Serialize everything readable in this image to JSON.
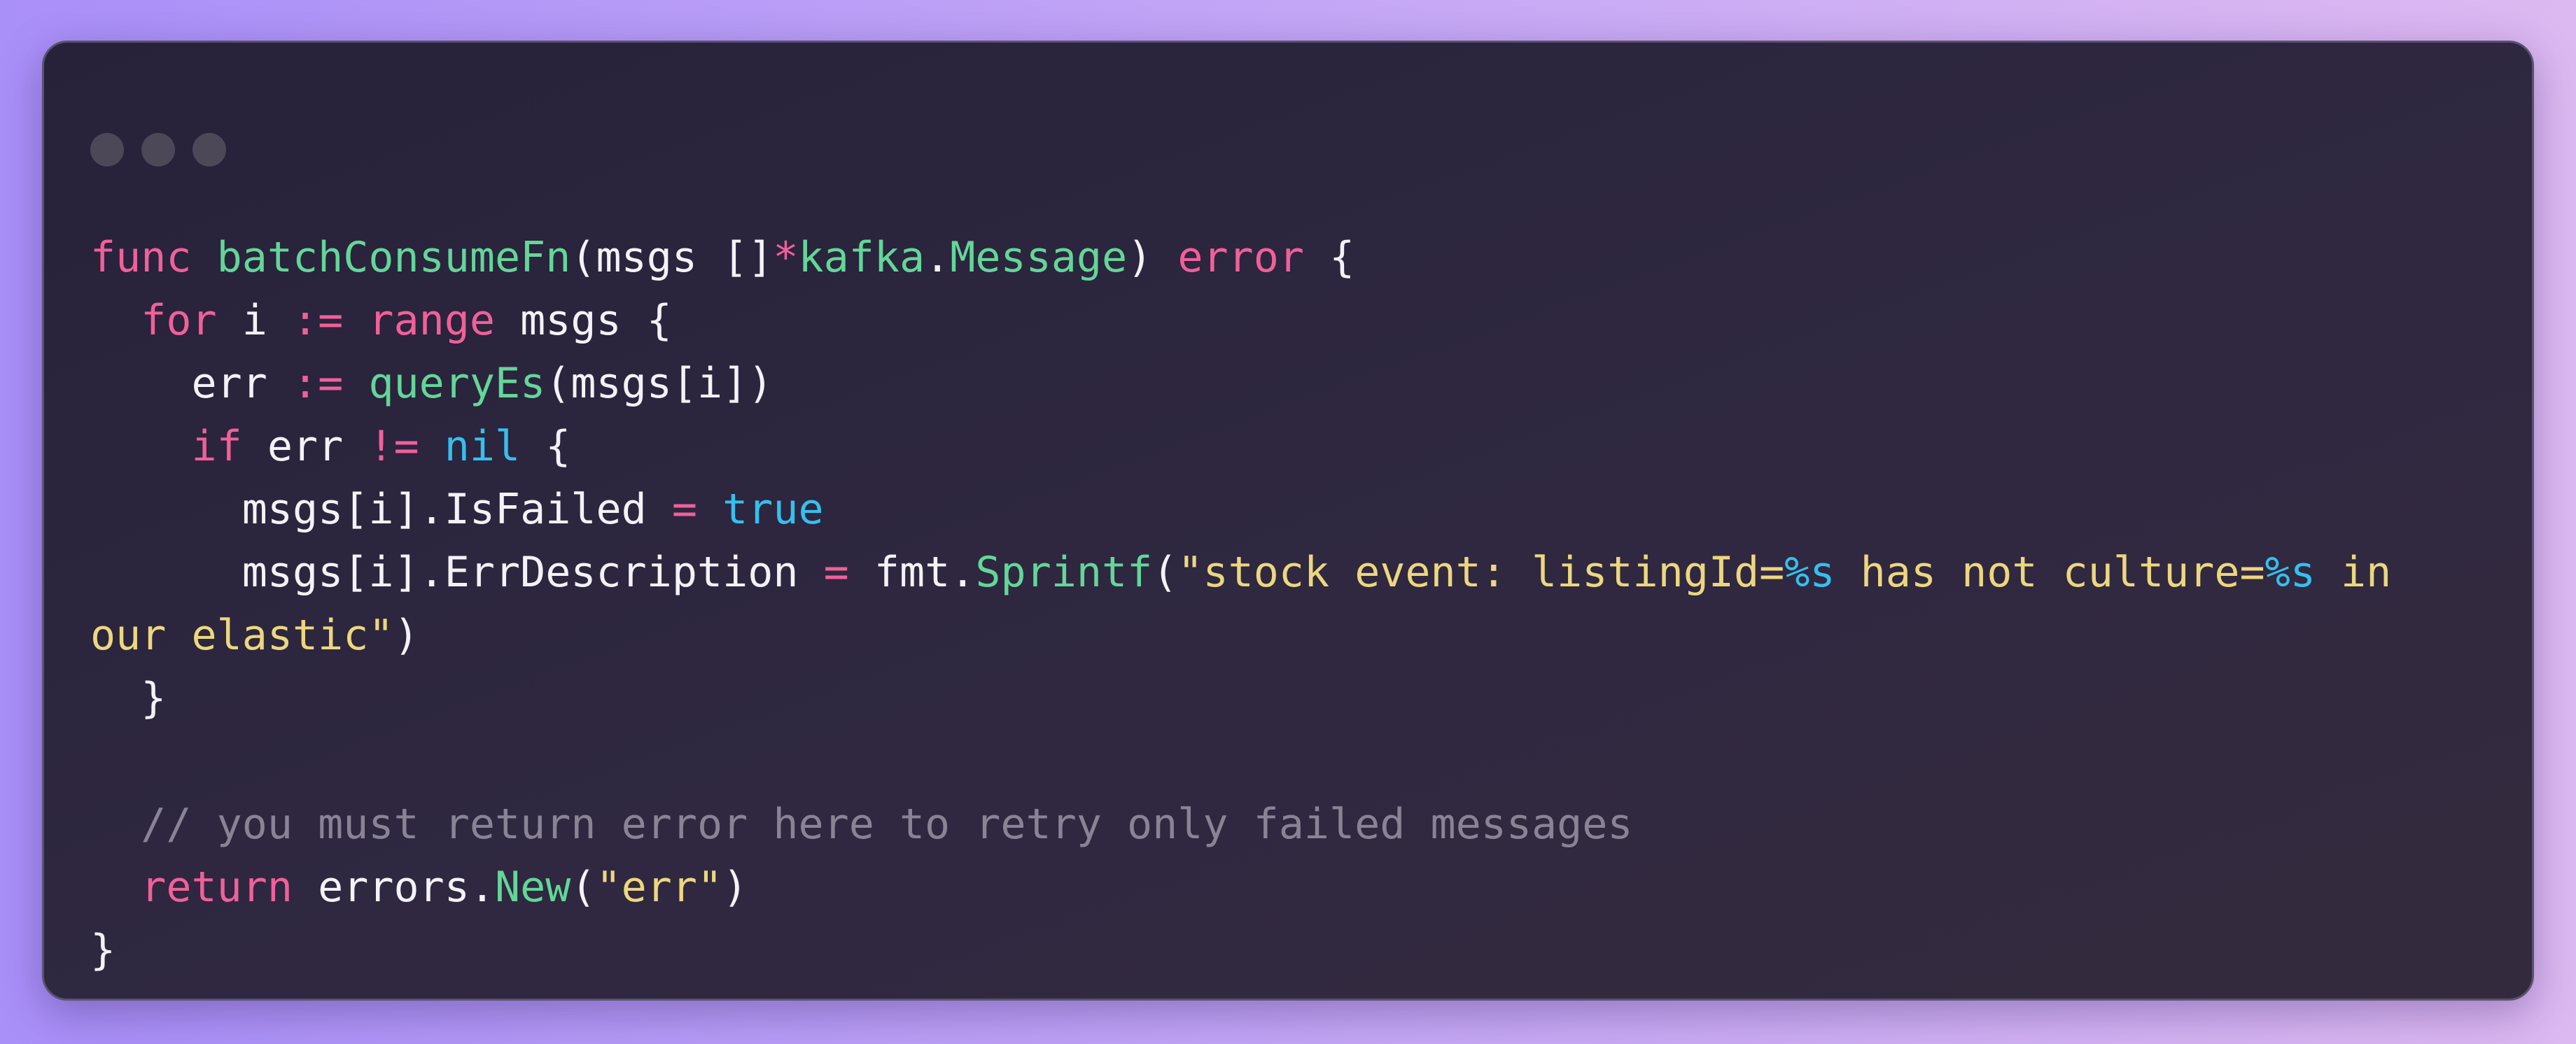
{
  "window": {
    "controls": [
      "close",
      "minimize",
      "zoom"
    ]
  },
  "code_lines": [
    [
      {
        "t": "func",
        "c": "kw"
      },
      {
        "t": " ",
        "c": "pl"
      },
      {
        "t": "batchConsumeFn",
        "c": "fn"
      },
      {
        "t": "(msgs []",
        "c": "pl"
      },
      {
        "t": "*",
        "c": "op"
      },
      {
        "t": "kafka",
        "c": "fn"
      },
      {
        "t": ".",
        "c": "pl"
      },
      {
        "t": "Message",
        "c": "fn"
      },
      {
        "t": ") ",
        "c": "pl"
      },
      {
        "t": "error",
        "c": "kw"
      },
      {
        "t": " {",
        "c": "pl"
      }
    ],
    [
      {
        "t": "  ",
        "c": "pl"
      },
      {
        "t": "for",
        "c": "kw"
      },
      {
        "t": " i ",
        "c": "pl"
      },
      {
        "t": ":=",
        "c": "op"
      },
      {
        "t": " ",
        "c": "pl"
      },
      {
        "t": "range",
        "c": "kw"
      },
      {
        "t": " msgs {",
        "c": "pl"
      }
    ],
    [
      {
        "t": "    err ",
        "c": "pl"
      },
      {
        "t": ":=",
        "c": "op"
      },
      {
        "t": " ",
        "c": "pl"
      },
      {
        "t": "queryEs",
        "c": "fn"
      },
      {
        "t": "(msgs[i])",
        "c": "pl"
      }
    ],
    [
      {
        "t": "    ",
        "c": "pl"
      },
      {
        "t": "if",
        "c": "kw"
      },
      {
        "t": " err ",
        "c": "pl"
      },
      {
        "t": "!=",
        "c": "op"
      },
      {
        "t": " ",
        "c": "pl"
      },
      {
        "t": "nil",
        "c": "num"
      },
      {
        "t": " {",
        "c": "pl"
      }
    ],
    [
      {
        "t": "      msgs[i].IsFailed ",
        "c": "pl"
      },
      {
        "t": "=",
        "c": "op"
      },
      {
        "t": " ",
        "c": "pl"
      },
      {
        "t": "true",
        "c": "num"
      }
    ],
    [
      {
        "t": "      msgs[i].ErrDescription ",
        "c": "pl"
      },
      {
        "t": "=",
        "c": "op"
      },
      {
        "t": " fmt.",
        "c": "pl"
      },
      {
        "t": "Sprintf",
        "c": "fn"
      },
      {
        "t": "(",
        "c": "pl"
      },
      {
        "t": "\"stock event: listingId=",
        "c": "str"
      },
      {
        "t": "%s",
        "c": "num"
      },
      {
        "t": " has not culture=",
        "c": "str"
      },
      {
        "t": "%s",
        "c": "num"
      },
      {
        "t": " in",
        "c": "str"
      }
    ],
    [
      {
        "t": "our elastic\"",
        "c": "str"
      },
      {
        "t": ")",
        "c": "pl"
      }
    ],
    [
      {
        "t": "  }",
        "c": "pl"
      }
    ],
    [],
    [
      {
        "t": "  // you must return error here to retry only failed messages",
        "c": "cm"
      }
    ],
    [
      {
        "t": "  ",
        "c": "pl"
      },
      {
        "t": "return",
        "c": "kw"
      },
      {
        "t": " errors.",
        "c": "pl"
      },
      {
        "t": "New",
        "c": "fn"
      },
      {
        "t": "(",
        "c": "pl"
      },
      {
        "t": "\"err\"",
        "c": "str"
      },
      {
        "t": ")",
        "c": "pl"
      }
    ],
    [
      {
        "t": "}",
        "c": "pl"
      }
    ]
  ]
}
